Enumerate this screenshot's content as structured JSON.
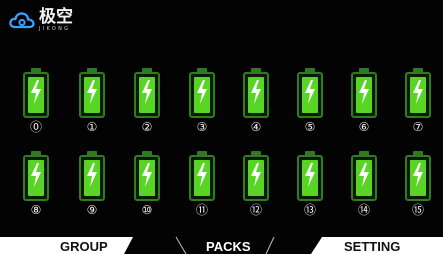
{
  "brand": {
    "name_cn": "极空",
    "name_en": "JIKONG"
  },
  "packs": [
    {
      "index": 0,
      "label": "⓪"
    },
    {
      "index": 1,
      "label": "①"
    },
    {
      "index": 2,
      "label": "②"
    },
    {
      "index": 3,
      "label": "③"
    },
    {
      "index": 4,
      "label": "④"
    },
    {
      "index": 5,
      "label": "⑤"
    },
    {
      "index": 6,
      "label": "⑥"
    },
    {
      "index": 7,
      "label": "⑦"
    },
    {
      "index": 8,
      "label": "⑧"
    },
    {
      "index": 9,
      "label": "⑨"
    },
    {
      "index": 10,
      "label": "⑩"
    },
    {
      "index": 11,
      "label": "⑪"
    },
    {
      "index": 12,
      "label": "⑫"
    },
    {
      "index": 13,
      "label": "⑬"
    },
    {
      "index": 14,
      "label": "⑭"
    },
    {
      "index": 15,
      "label": "⑮"
    }
  ],
  "tabs": [
    {
      "id": "group",
      "label": "GROUP",
      "active": false
    },
    {
      "id": "packs",
      "label": "PACKS",
      "active": true
    },
    {
      "id": "setting",
      "label": "SETTING",
      "active": false
    }
  ],
  "colors": {
    "battery_fill": "#58d424",
    "battery_frame": "#2e7d1f",
    "tab_bg": "#ffffff",
    "active_tab_bg": "#000000"
  }
}
